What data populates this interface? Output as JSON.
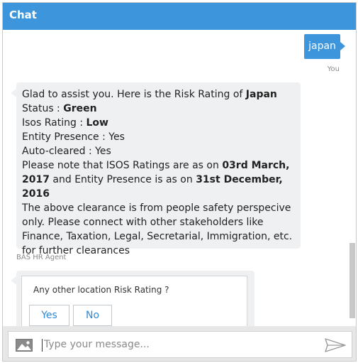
{
  "header": {
    "title": "Chat"
  },
  "messages": {
    "user_message": {
      "text": "japan",
      "sender": "You"
    },
    "bot_message": {
      "line1_prefix": "Glad to assist you. Here is the Risk Rating of ",
      "line1_bold": "Japan",
      "line2_prefix": "Status : ",
      "line2_bold": "Green",
      "line3_prefix": "Isos Rating : ",
      "line3_bold": "Low",
      "line4": "Entity Presence : Yes",
      "line5": "Auto-cleared : Yes",
      "note_prefix": "Please note that ISOS Ratings are as on ",
      "note_bold1": "03rd March, 2017",
      "note_middle": " and Entity Presence is as on ",
      "note_bold2": "31st December, 2016",
      "clearance": "The above clearance is from people safety perspecive only. Please connect with other stakeholders like Finance, Taxation, Legal, Secretarial, Immigration, etc. for further clearances",
      "sender": "BAS HR Agent"
    },
    "quick_reply": {
      "question": "Any other location Risk Rating ?",
      "options": [
        "Yes",
        "No"
      ]
    }
  },
  "composer": {
    "placeholder": "Type your message...",
    "attach_icon": "image-icon",
    "send_icon": "send-icon"
  },
  "colors": {
    "accent": "#3d95dc",
    "bot_bubble": "#eef0f2",
    "footer": "#e7e7e7"
  }
}
